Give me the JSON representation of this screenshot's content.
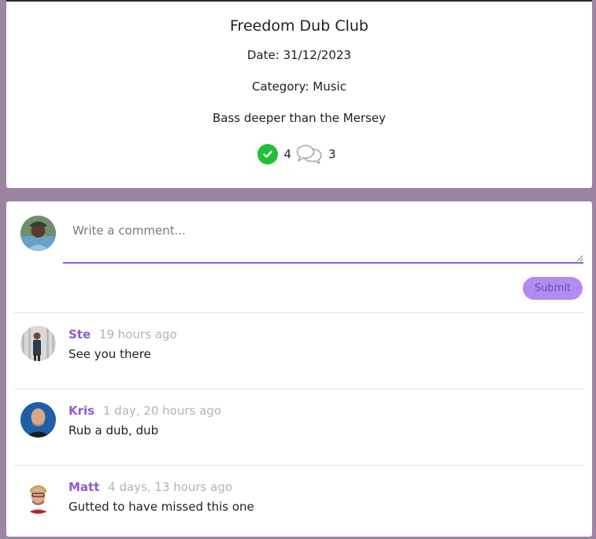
{
  "event": {
    "title": "Freedom Dub Club",
    "date_label": "Date: 31/12/2023",
    "category_label": "Category: Music",
    "description": "Bass deeper than the Mersey",
    "attending_count": "4",
    "comments_count": "3"
  },
  "comment_form": {
    "placeholder": "Write a comment...",
    "submit_label": "Submit"
  },
  "comments": [
    {
      "author": "Ste",
      "time": "19 hours ago",
      "text": "See you there"
    },
    {
      "author": "Kris",
      "time": "1 day, 20 hours ago",
      "text": "Rub a dub, dub"
    },
    {
      "author": "Matt",
      "time": "4 days, 13 hours ago",
      "text": "Gutted to have missed this one"
    }
  ],
  "colors": {
    "page_background": "#9c84a3",
    "accent": "#8f58d6",
    "check": "#22c03a",
    "submit_button": "#b18cf0"
  },
  "icons": [
    "check-circle-icon",
    "comments-icon"
  ]
}
